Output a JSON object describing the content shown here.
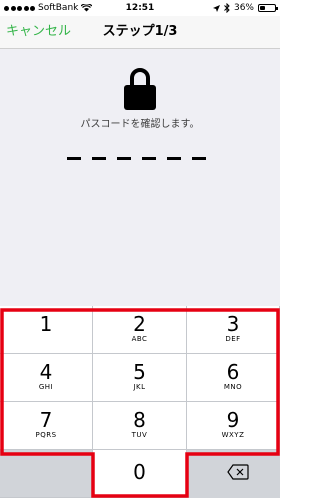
{
  "status_bar": {
    "carrier": "SoftBank",
    "time": "12:51",
    "battery": "36%",
    "battery_level": 0.36,
    "icons": [
      "signal-dots-icon",
      "wifi-icon",
      "location-arrow-icon",
      "bluetooth-icon",
      "battery-icon"
    ]
  },
  "nav": {
    "cancel_label": "キャンセル",
    "title": "ステップ1/3"
  },
  "content": {
    "lock_icon": "lock-icon",
    "prompt": "パスコードを確認します。",
    "passcode_length": 6
  },
  "keypad": {
    "keys": [
      {
        "num": "1",
        "letters": ""
      },
      {
        "num": "2",
        "letters": "ABC"
      },
      {
        "num": "3",
        "letters": "DEF"
      },
      {
        "num": "4",
        "letters": "GHI"
      },
      {
        "num": "5",
        "letters": "JKL"
      },
      {
        "num": "6",
        "letters": "MNO"
      },
      {
        "num": "7",
        "letters": "PQRS"
      },
      {
        "num": "8",
        "letters": "TUV"
      },
      {
        "num": "9",
        "letters": "WXYZ"
      },
      {
        "num": "0",
        "letters": ""
      }
    ],
    "delete_icon": "backspace-icon"
  },
  "colors": {
    "accent_green": "#35b54a",
    "highlight_red": "#e60012",
    "content_bg": "#efeff4",
    "keypad_bg": "#d1d4d9"
  }
}
